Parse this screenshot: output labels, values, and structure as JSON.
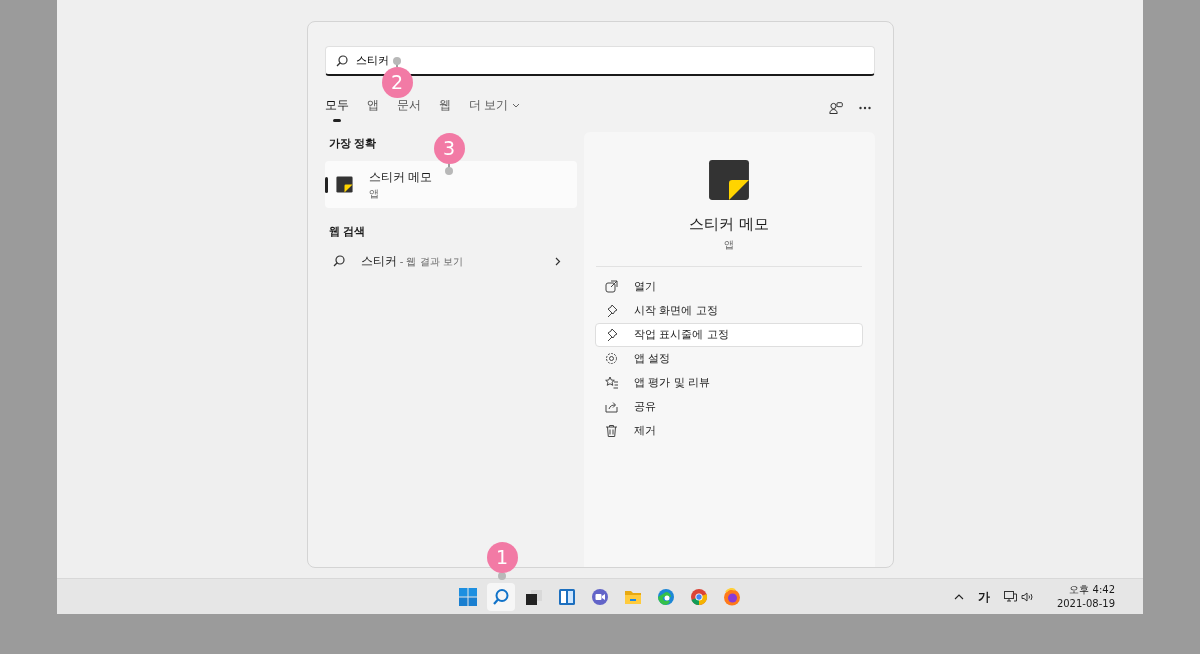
{
  "search": {
    "value": "스티커"
  },
  "filters": [
    {
      "label": "모두",
      "selected": true,
      "kind": "tab"
    },
    {
      "label": "앱",
      "selected": false,
      "kind": "tab"
    },
    {
      "label": "문서",
      "selected": false,
      "kind": "tab"
    },
    {
      "label": "웹",
      "selected": false,
      "kind": "tab"
    },
    {
      "label": "더 보기",
      "selected": false,
      "kind": "dropdown"
    }
  ],
  "best_match": {
    "heading": "가장 정확",
    "name": "스티커 메모",
    "type": "앱",
    "selected": true
  },
  "web_search": {
    "heading": "웹 검색",
    "query": "스티커",
    "suffix": "- 웹 결과 보기"
  },
  "detail": {
    "name": "스티커 메모",
    "type": "앱",
    "actions": [
      {
        "label": "열기",
        "hovered": false
      },
      {
        "label": "시작 화면에 고정",
        "hovered": false
      },
      {
        "label": "작업 표시줄에 고정",
        "hovered": true
      },
      {
        "label": "앱 설정",
        "hovered": false
      },
      {
        "label": "앱 평가 및 리뷰",
        "hovered": false
      },
      {
        "label": "공유",
        "hovered": false
      },
      {
        "label": "제거",
        "hovered": false
      }
    ]
  },
  "taskbar": {
    "apps": [
      {
        "active": false
      },
      {
        "active": true
      },
      {
        "active": false
      },
      {
        "active": false
      },
      {
        "active": false
      },
      {
        "active": false
      },
      {
        "active": false
      },
      {
        "active": false
      },
      {
        "active": false
      }
    ]
  },
  "tray": {
    "ime": "가",
    "time": "오후 4:42",
    "date": "2021-08-19"
  },
  "annotations": [
    {
      "number": "1"
    },
    {
      "number": "2"
    },
    {
      "number": "3"
    }
  ]
}
